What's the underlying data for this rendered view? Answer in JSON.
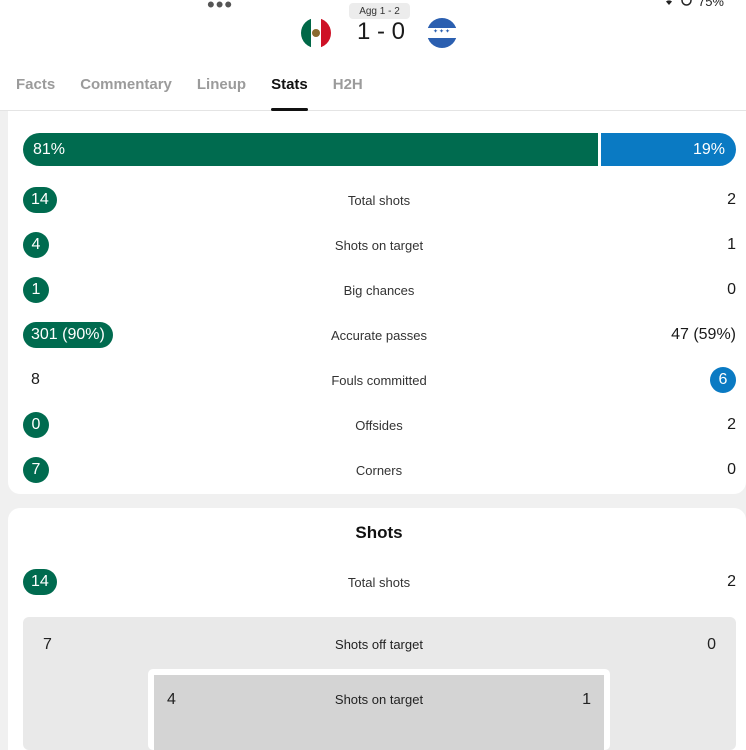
{
  "header": {
    "dots": "•••",
    "battery_text": "75%",
    "aggregate": "Agg 1 - 2",
    "score": "1 - 0",
    "home_flag_icon": "mexico-flag-icon",
    "away_flag_icon": "honduras-flag-icon"
  },
  "tabs": [
    {
      "label": "Facts"
    },
    {
      "label": "Commentary"
    },
    {
      "label": "Lineup"
    },
    {
      "label": "Stats"
    },
    {
      "label": "H2H"
    }
  ],
  "active_tab": "Stats",
  "colors": {
    "home": "#006b4f",
    "away": "#0a7ac3"
  },
  "possession": {
    "home": "81%",
    "away": "19%",
    "home_fraction": 0.81
  },
  "top_stats": [
    {
      "label": "Total shots",
      "home": "14",
      "away": "2",
      "highlight": "home"
    },
    {
      "label": "Shots on target",
      "home": "4",
      "away": "1",
      "highlight": "home"
    },
    {
      "label": "Big chances",
      "home": "1",
      "away": "0",
      "highlight": "home"
    },
    {
      "label": "Accurate passes",
      "home": "301 (90%)",
      "away": "47 (59%)",
      "highlight": "home"
    },
    {
      "label": "Fouls committed",
      "home": "8",
      "away": "6",
      "highlight": "away"
    },
    {
      "label": "Offsides",
      "home": "0",
      "away": "2",
      "highlight": "home"
    },
    {
      "label": "Corners",
      "home": "7",
      "away": "0",
      "highlight": "home"
    }
  ],
  "shots_section": {
    "title": "Shots",
    "total": {
      "label": "Total shots",
      "home": "14",
      "away": "2"
    },
    "off_target": {
      "label": "Shots off target",
      "home": "7",
      "away": "0"
    },
    "on_target": {
      "label": "Shots on target",
      "home": "4",
      "away": "1"
    }
  }
}
